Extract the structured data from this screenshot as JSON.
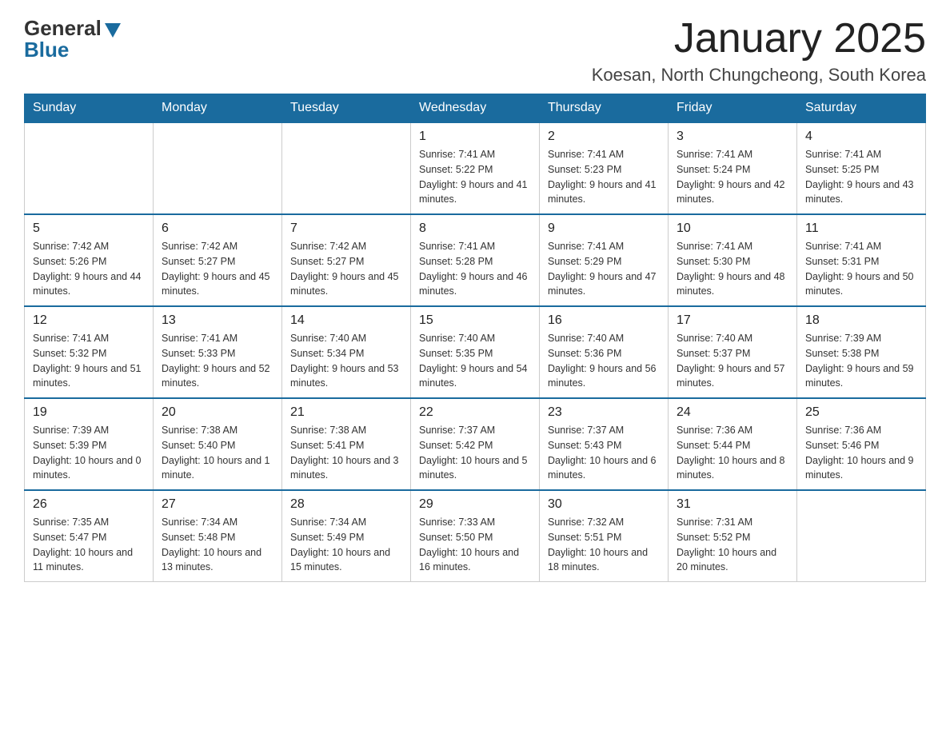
{
  "logo": {
    "general": "General",
    "blue": "Blue"
  },
  "title": "January 2025",
  "location": "Koesan, North Chungcheong, South Korea",
  "days_of_week": [
    "Sunday",
    "Monday",
    "Tuesday",
    "Wednesday",
    "Thursday",
    "Friday",
    "Saturday"
  ],
  "weeks": [
    [
      {
        "day": "",
        "info": ""
      },
      {
        "day": "",
        "info": ""
      },
      {
        "day": "",
        "info": ""
      },
      {
        "day": "1",
        "info": "Sunrise: 7:41 AM\nSunset: 5:22 PM\nDaylight: 9 hours and 41 minutes."
      },
      {
        "day": "2",
        "info": "Sunrise: 7:41 AM\nSunset: 5:23 PM\nDaylight: 9 hours and 41 minutes."
      },
      {
        "day": "3",
        "info": "Sunrise: 7:41 AM\nSunset: 5:24 PM\nDaylight: 9 hours and 42 minutes."
      },
      {
        "day": "4",
        "info": "Sunrise: 7:41 AM\nSunset: 5:25 PM\nDaylight: 9 hours and 43 minutes."
      }
    ],
    [
      {
        "day": "5",
        "info": "Sunrise: 7:42 AM\nSunset: 5:26 PM\nDaylight: 9 hours and 44 minutes."
      },
      {
        "day": "6",
        "info": "Sunrise: 7:42 AM\nSunset: 5:27 PM\nDaylight: 9 hours and 45 minutes."
      },
      {
        "day": "7",
        "info": "Sunrise: 7:42 AM\nSunset: 5:27 PM\nDaylight: 9 hours and 45 minutes."
      },
      {
        "day": "8",
        "info": "Sunrise: 7:41 AM\nSunset: 5:28 PM\nDaylight: 9 hours and 46 minutes."
      },
      {
        "day": "9",
        "info": "Sunrise: 7:41 AM\nSunset: 5:29 PM\nDaylight: 9 hours and 47 minutes."
      },
      {
        "day": "10",
        "info": "Sunrise: 7:41 AM\nSunset: 5:30 PM\nDaylight: 9 hours and 48 minutes."
      },
      {
        "day": "11",
        "info": "Sunrise: 7:41 AM\nSunset: 5:31 PM\nDaylight: 9 hours and 50 minutes."
      }
    ],
    [
      {
        "day": "12",
        "info": "Sunrise: 7:41 AM\nSunset: 5:32 PM\nDaylight: 9 hours and 51 minutes."
      },
      {
        "day": "13",
        "info": "Sunrise: 7:41 AM\nSunset: 5:33 PM\nDaylight: 9 hours and 52 minutes."
      },
      {
        "day": "14",
        "info": "Sunrise: 7:40 AM\nSunset: 5:34 PM\nDaylight: 9 hours and 53 minutes."
      },
      {
        "day": "15",
        "info": "Sunrise: 7:40 AM\nSunset: 5:35 PM\nDaylight: 9 hours and 54 minutes."
      },
      {
        "day": "16",
        "info": "Sunrise: 7:40 AM\nSunset: 5:36 PM\nDaylight: 9 hours and 56 minutes."
      },
      {
        "day": "17",
        "info": "Sunrise: 7:40 AM\nSunset: 5:37 PM\nDaylight: 9 hours and 57 minutes."
      },
      {
        "day": "18",
        "info": "Sunrise: 7:39 AM\nSunset: 5:38 PM\nDaylight: 9 hours and 59 minutes."
      }
    ],
    [
      {
        "day": "19",
        "info": "Sunrise: 7:39 AM\nSunset: 5:39 PM\nDaylight: 10 hours and 0 minutes."
      },
      {
        "day": "20",
        "info": "Sunrise: 7:38 AM\nSunset: 5:40 PM\nDaylight: 10 hours and 1 minute."
      },
      {
        "day": "21",
        "info": "Sunrise: 7:38 AM\nSunset: 5:41 PM\nDaylight: 10 hours and 3 minutes."
      },
      {
        "day": "22",
        "info": "Sunrise: 7:37 AM\nSunset: 5:42 PM\nDaylight: 10 hours and 5 minutes."
      },
      {
        "day": "23",
        "info": "Sunrise: 7:37 AM\nSunset: 5:43 PM\nDaylight: 10 hours and 6 minutes."
      },
      {
        "day": "24",
        "info": "Sunrise: 7:36 AM\nSunset: 5:44 PM\nDaylight: 10 hours and 8 minutes."
      },
      {
        "day": "25",
        "info": "Sunrise: 7:36 AM\nSunset: 5:46 PM\nDaylight: 10 hours and 9 minutes."
      }
    ],
    [
      {
        "day": "26",
        "info": "Sunrise: 7:35 AM\nSunset: 5:47 PM\nDaylight: 10 hours and 11 minutes."
      },
      {
        "day": "27",
        "info": "Sunrise: 7:34 AM\nSunset: 5:48 PM\nDaylight: 10 hours and 13 minutes."
      },
      {
        "day": "28",
        "info": "Sunrise: 7:34 AM\nSunset: 5:49 PM\nDaylight: 10 hours and 15 minutes."
      },
      {
        "day": "29",
        "info": "Sunrise: 7:33 AM\nSunset: 5:50 PM\nDaylight: 10 hours and 16 minutes."
      },
      {
        "day": "30",
        "info": "Sunrise: 7:32 AM\nSunset: 5:51 PM\nDaylight: 10 hours and 18 minutes."
      },
      {
        "day": "31",
        "info": "Sunrise: 7:31 AM\nSunset: 5:52 PM\nDaylight: 10 hours and 20 minutes."
      },
      {
        "day": "",
        "info": ""
      }
    ]
  ]
}
